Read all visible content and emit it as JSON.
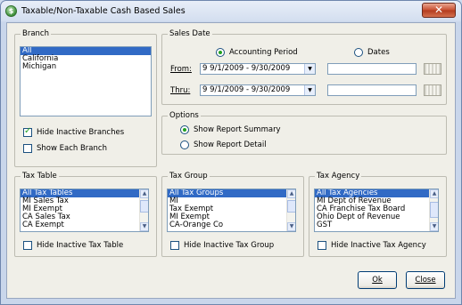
{
  "window": {
    "title": "Taxable/Non-Taxable Cash Based Sales",
    "app_icon_letter": "$",
    "close_label": "✕"
  },
  "branch": {
    "legend": "Branch",
    "items": [
      "All",
      "California",
      "Michigan"
    ],
    "selected_index": 0,
    "hide_inactive_label": "Hide Inactive Branches",
    "hide_inactive_checked": true,
    "show_each_label": "Show Each Branch",
    "show_each_checked": false
  },
  "sales_date": {
    "legend": "Sales Date",
    "accounting_period_label": "Accounting Period",
    "dates_label": "Dates",
    "selected": "accounting_period",
    "from_label": "From:",
    "from_value": "9  9/1/2009 - 9/30/2009",
    "thru_label": "Thru:",
    "thru_value": "9  9/1/2009 - 9/30/2009",
    "from_date_text": "",
    "thru_date_text": ""
  },
  "options": {
    "legend": "Options",
    "summary_label": "Show Report Summary",
    "detail_label": "Show Report Detail",
    "selected": "summary"
  },
  "tax_table": {
    "legend": "Tax Table",
    "items": [
      "All Tax Tables",
      "MI Sales Tax",
      "MI Exempt",
      "CA Sales Tax",
      "CA Exempt"
    ],
    "selected_index": 0,
    "hide_label": "Hide Inactive Tax Table",
    "hide_checked": false
  },
  "tax_group": {
    "legend": "Tax Group",
    "items": [
      "All Tax Groups",
      "MI",
      "Tax Exempt",
      "MI Exempt",
      "CA-Orange Co"
    ],
    "selected_index": 0,
    "hide_label": "Hide Inactive Tax Group",
    "hide_checked": false
  },
  "tax_agency": {
    "legend": "Tax Agency",
    "items": [
      "All Tax Agencies",
      "MI Dept of Revenue",
      "CA Franchise Tax Board",
      "Ohio Dept of Revenue",
      "GST"
    ],
    "selected_index": 0,
    "hide_label": "Hide Inactive Tax Agency",
    "hide_checked": false
  },
  "buttons": {
    "ok_label": "Ok",
    "close_label": "Close"
  },
  "icons": {
    "dropdown": "chevron-down-icon",
    "scroll_up": "arrow-up-icon",
    "scroll_down": "arrow-down-icon",
    "calendar": "calendar-icon"
  }
}
